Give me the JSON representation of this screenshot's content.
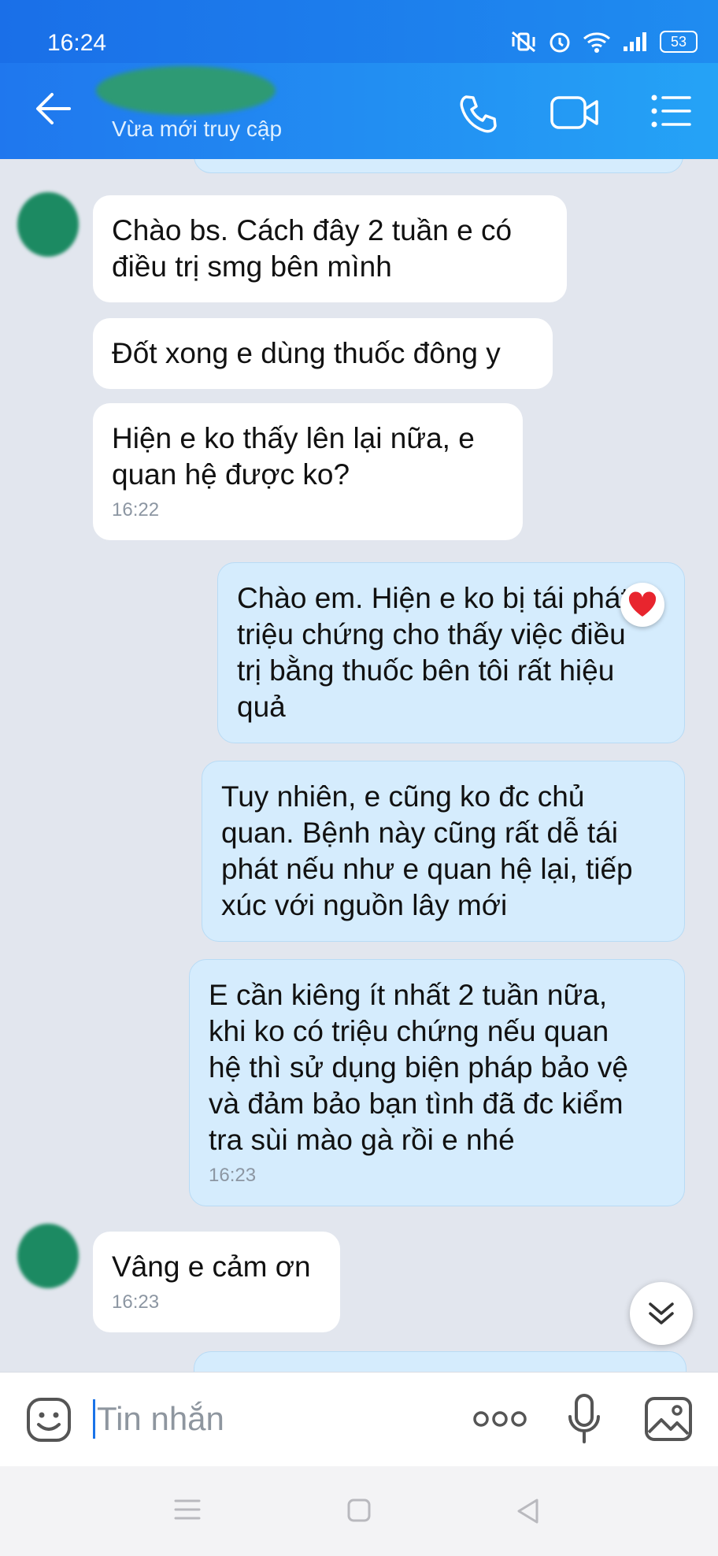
{
  "status_bar": {
    "time": "16:24",
    "battery": "53"
  },
  "header": {
    "subtitle": "Vừa mới truy cập"
  },
  "messages": [
    {
      "side": "in",
      "text": "Chào bs. Cách đây 2 tuần e có\nđiều trị smg bên mình",
      "time": ""
    },
    {
      "side": "in",
      "text": "Đốt xong e dùng thuốc đông y",
      "time": ""
    },
    {
      "side": "in",
      "text": "Hiện e ko thấy lên lại nữa, e\nquan hệ được ko?",
      "time": "16:22"
    },
    {
      "side": "out",
      "text": "Chào em. Hiện e ko bị tái phát\ntriệu chứng cho thấy việc điều\ntrị bằng thuốc bên tôi rất hiệu\nquả",
      "time": "",
      "reaction": "heart"
    },
    {
      "side": "out",
      "text": "Tuy nhiên, e cũng ko đc chủ\nquan. Bệnh này cũng rất dễ tái\nphát nếu như e quan hệ lại, tiếp\nxúc với nguồn lây mới",
      "time": ""
    },
    {
      "side": "out",
      "text": "E cần kiêng ít nhất 2 tuần nữa,\nkhi ko có triệu chứng nếu quan\nhệ thì sử dụng biện pháp bảo vệ\nvà đảm bảo bạn tình đã đc kiểm\ntra sùi mào gà rồi e nhé",
      "time": "16:23"
    },
    {
      "side": "in",
      "text": "Vâng e cảm ơn",
      "time": "16:23"
    }
  ],
  "composer": {
    "placeholder": "Tin nhắn"
  },
  "colors": {
    "header": "#1f8cf0",
    "incoming": "#ffffff",
    "outgoing": "#d5ecfd",
    "heart": "#e8252e"
  },
  "icons": [
    "back-arrow-icon",
    "phone-icon",
    "video-call-icon",
    "menu-icon",
    "emoji-icon",
    "more-icon",
    "mic-icon",
    "image-icon",
    "scroll-down-icon"
  ]
}
